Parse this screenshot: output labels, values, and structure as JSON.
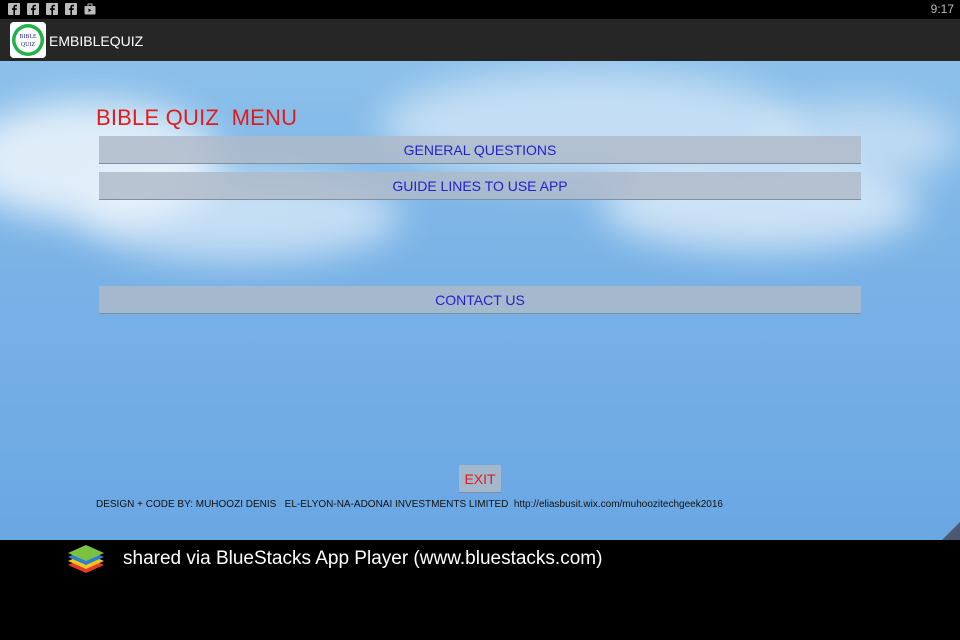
{
  "status_bar": {
    "time": "9:17",
    "icons": [
      "facebook-icon",
      "facebook-icon",
      "facebook-icon",
      "facebook-icon",
      "briefcase-icon"
    ]
  },
  "app_bar": {
    "logo_text_line1": "BIBLE",
    "logo_text_line2": "QUIZ",
    "title": "EMBIBLEQUIZ"
  },
  "menu": {
    "title": "BIBLE QUIZ  MENU",
    "general_questions": "GENERAL QUESTIONS",
    "guidelines": "GUIDE LINES TO USE APP",
    "contact_us": "CONTACT US",
    "exit": "EXIT"
  },
  "credits": "DESIGN + CODE BY: MUHOOZI DENIS   EL-ELYON-NA-ADONAI INVESTMENTS LIMITED  http://eliasbusit.wix.com/muhoozitechgeek2016",
  "footer": {
    "text": "shared via BlueStacks App Player (www.bluestacks.com)"
  },
  "colors": {
    "title_red": "#e31b1b",
    "button_text_blue": "#2222cc",
    "sky_blue": "#79b2e6",
    "app_bar": "#262626"
  }
}
